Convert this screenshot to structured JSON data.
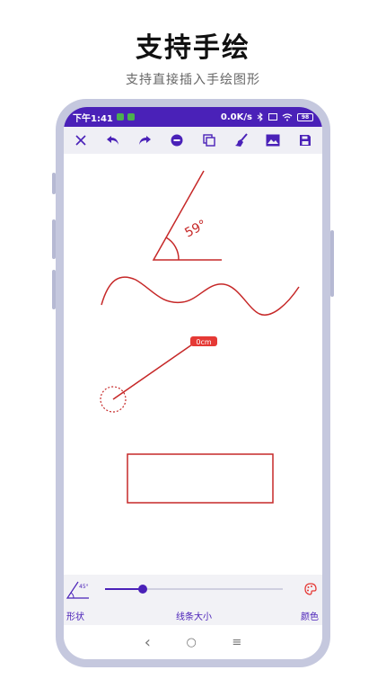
{
  "promo": {
    "title": "支持手绘",
    "subtitle": "支持直接插入手绘图形"
  },
  "status_bar": {
    "time": "下午1:41",
    "speed": "0.0K/s",
    "battery": "98"
  },
  "toolbar": {
    "icons": [
      "close-icon",
      "undo-icon",
      "redo-icon",
      "remove-icon",
      "copy-icon",
      "brush-icon",
      "image-icon",
      "save-icon"
    ]
  },
  "canvas": {
    "angle_label": "59°",
    "measure_badge": "0cm",
    "stroke_color": "#c62828"
  },
  "bottom_panel": {
    "shape_label": "形状",
    "shape_icon_text": "45°",
    "line_size_label": "线条大小",
    "color_label": "颜色",
    "line_size_fraction": 0.21
  },
  "nav_bar": {
    "back": "‹",
    "home": "○",
    "menu": "≡"
  },
  "colors": {
    "accent": "#4a21b8",
    "stroke": "#c62828",
    "badge": "#e53935"
  }
}
